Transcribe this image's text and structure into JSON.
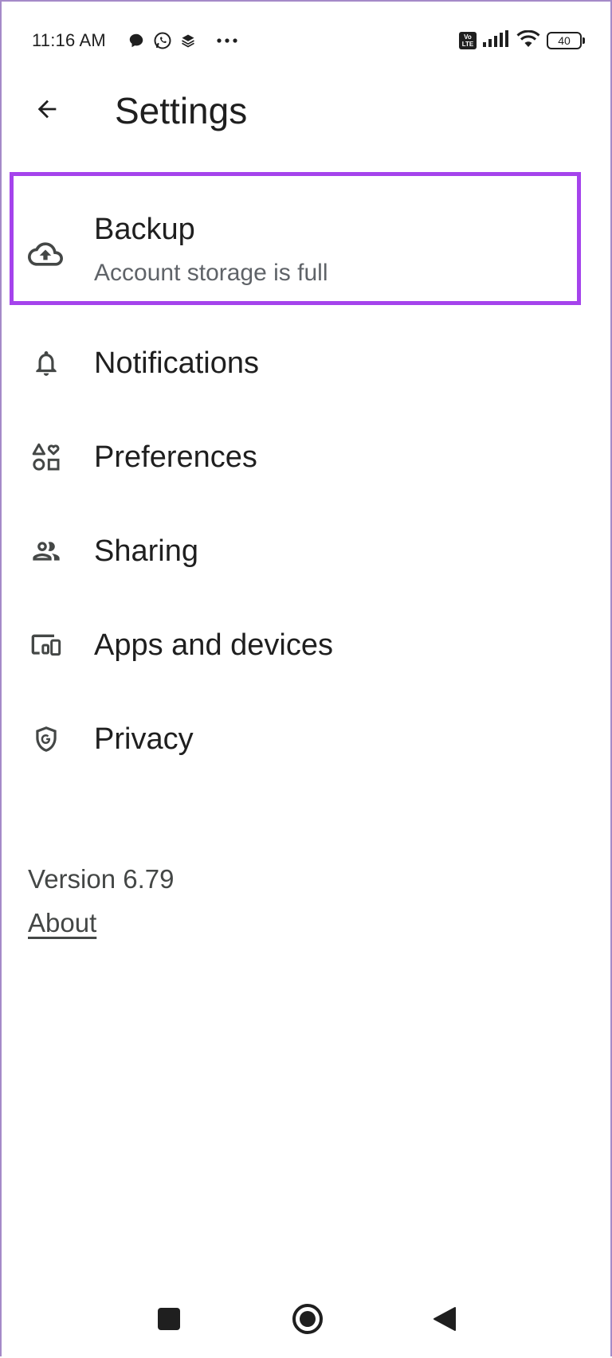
{
  "status_bar": {
    "time": "11:16 AM",
    "left_icons": [
      "chat-bubble-icon",
      "whatsapp-icon",
      "layers-icon",
      "more-dots-icon"
    ],
    "volte_label": "Vo LTE",
    "battery_level": "40"
  },
  "header": {
    "title": "Settings",
    "back_icon": "arrow-back-icon"
  },
  "settings": {
    "items": [
      {
        "label": "Backup",
        "sublabel": "Account storage is full",
        "icon": "cloud-upload-icon",
        "highlighted": true
      },
      {
        "label": "Notifications",
        "icon": "bell-icon"
      },
      {
        "label": "Preferences",
        "icon": "shapes-icon"
      },
      {
        "label": "Sharing",
        "icon": "people-icon"
      },
      {
        "label": "Apps and devices",
        "icon": "devices-icon"
      },
      {
        "label": "Privacy",
        "icon": "shield-g-icon"
      }
    ]
  },
  "footer": {
    "version": "Version 6.79",
    "about_label": "About"
  },
  "nav_bar": {
    "buttons": [
      "recents-square-icon",
      "home-circle-icon",
      "back-triangle-icon"
    ]
  },
  "colors": {
    "highlight": "#a543ec",
    "text_primary": "#1f1f1f",
    "text_secondary": "#5f6368"
  }
}
